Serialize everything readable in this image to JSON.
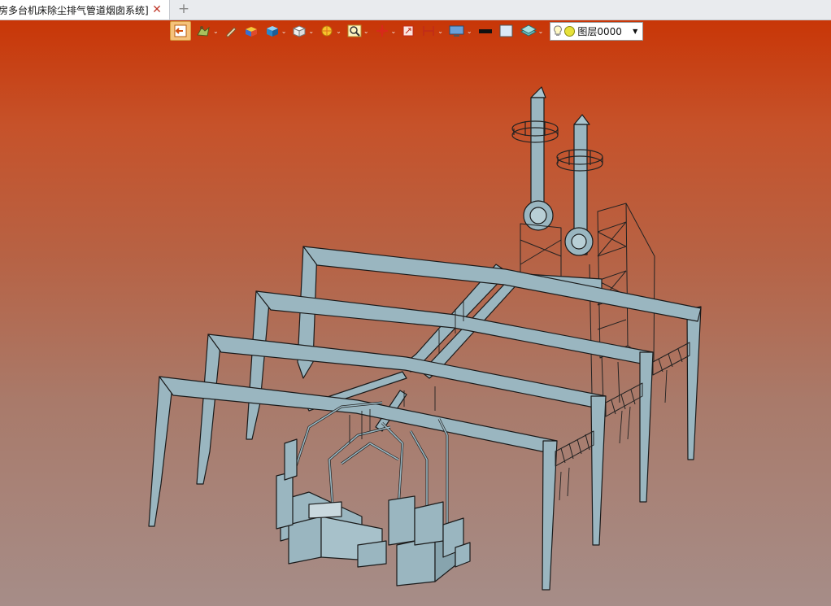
{
  "tab": {
    "title": "房多台机床除尘排气管道烟囱系统]",
    "close_glyph": "✕",
    "add_glyph": "+"
  },
  "toolbar": {
    "buttons": [
      "exit-icon",
      "material-icon",
      "pencil-icon",
      "box-color-icon",
      "cube-icon",
      "view-cube-icon",
      "sun-icon",
      "zoom-icon",
      "axis-icon",
      "transform-icon",
      "dimension-icon",
      "monitor-icon",
      "line-color-icon",
      "fill-color-icon",
      "layer-stack-icon"
    ],
    "layer_name": "图层0000"
  },
  "colors": {
    "bg_top": "#c83607",
    "bg_bottom": "#a68d88",
    "steel": "#9ab6c0",
    "outline": "#1a1a1a"
  }
}
